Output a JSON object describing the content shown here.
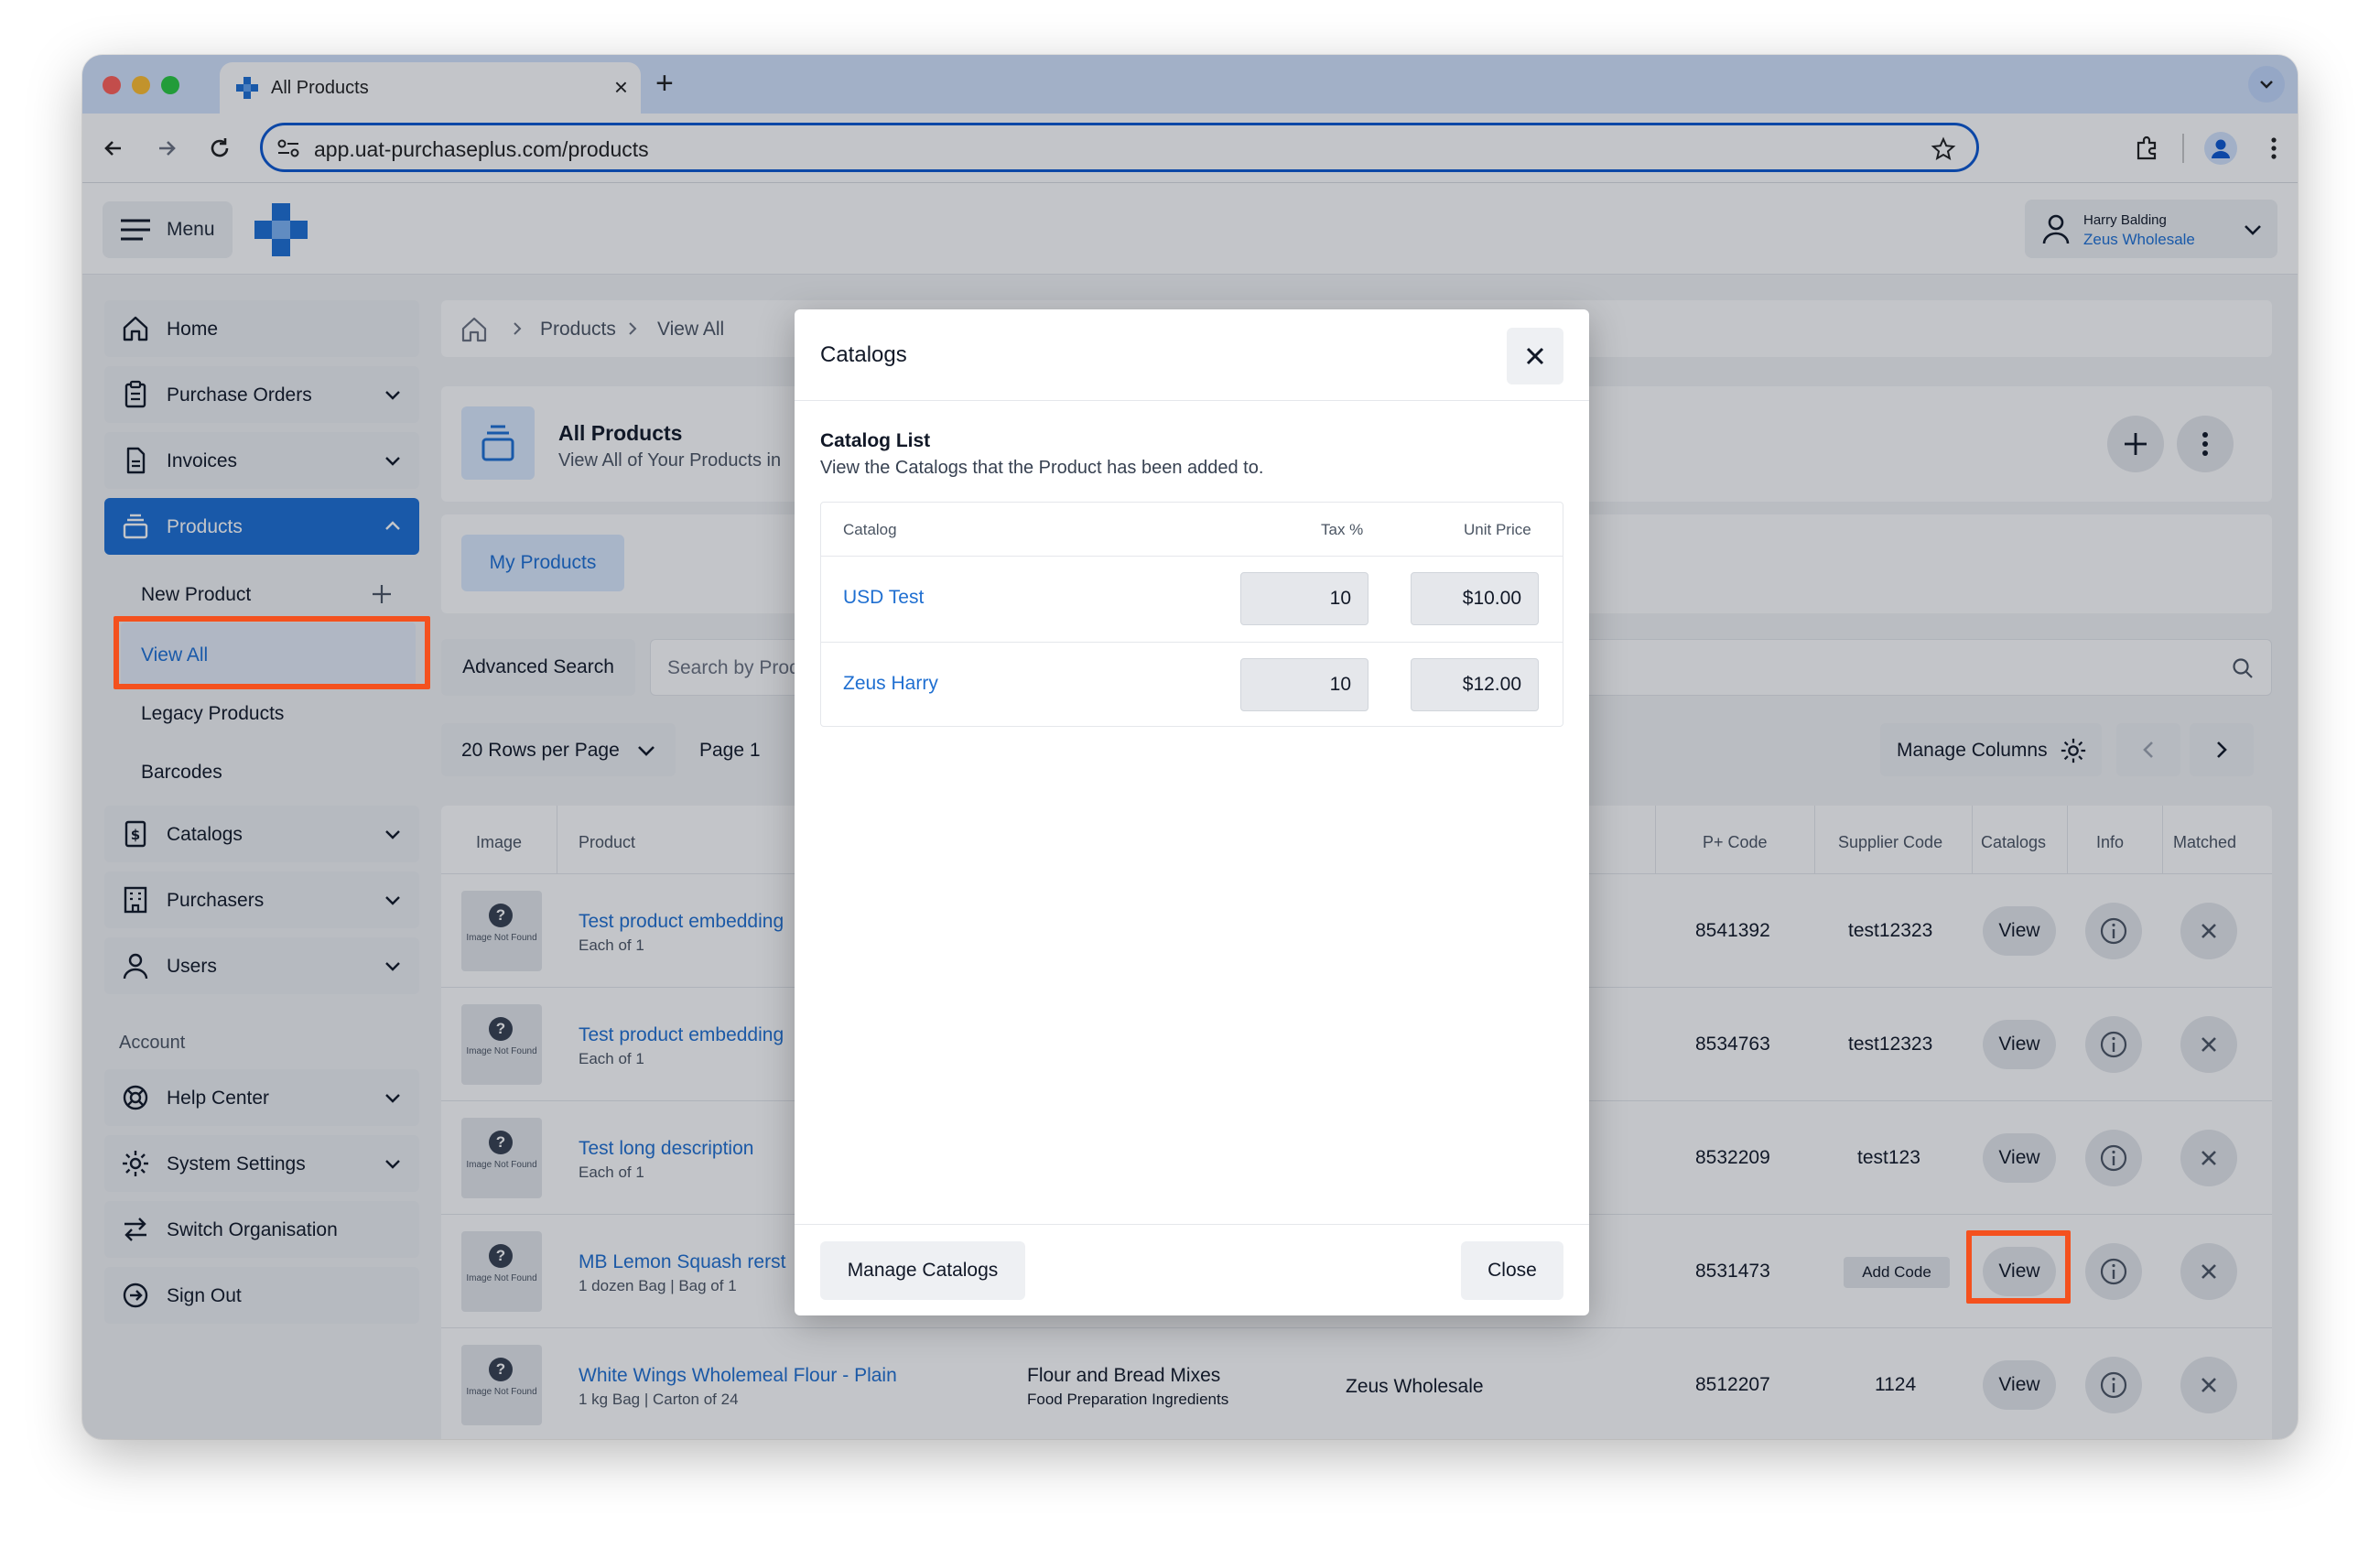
{
  "browser": {
    "tab_title": "All Products",
    "url": "app.uat-purchaseplus.com/products"
  },
  "header": {
    "menu_label": "Menu",
    "user_name": "Harry Balding",
    "user_org": "Zeus Wholesale"
  },
  "sidebar": {
    "items": [
      {
        "label": "Home"
      },
      {
        "label": "Purchase Orders"
      },
      {
        "label": "Invoices"
      },
      {
        "label": "Products"
      },
      {
        "label": "Catalogs"
      },
      {
        "label": "Purchasers"
      },
      {
        "label": "Users"
      }
    ],
    "products_sub": [
      "New Product",
      "View All",
      "Legacy Products",
      "Barcodes"
    ],
    "account_heading": "Account",
    "account_items": [
      {
        "label": "Help Center"
      },
      {
        "label": "System Settings"
      },
      {
        "label": "Switch Organisation"
      },
      {
        "label": "Sign Out"
      }
    ]
  },
  "breadcrumb": {
    "products": "Products",
    "view_all": "View All"
  },
  "page": {
    "title": "All Products",
    "subtitle": "View All of Your Products in",
    "tab_my_products": "My Products",
    "advanced_search": "Advanced Search",
    "search_placeholder": "Search by Prod",
    "rows_per_page": "20 Rows per Page",
    "page_label": "Page 1",
    "manage_columns": "Manage Columns"
  },
  "table": {
    "headers": {
      "image": "Image",
      "product": "Product",
      "p_code": "P+ Code",
      "supplier_code": "Supplier Code",
      "catalogs": "Catalogs",
      "info": "Info",
      "matched": "Matched"
    },
    "image_placeholder": "Image Not Found",
    "view_label": "View",
    "add_code_label": "Add Code",
    "rows": [
      {
        "name": "Test product embedding",
        "sub": "Each of 1",
        "p_code": "8541392",
        "supplier_code": "test12323"
      },
      {
        "name": "Test product embedding",
        "sub": "Each of 1",
        "p_code": "8534763",
        "supplier_code": "test12323"
      },
      {
        "name": "Test long description",
        "sub": "Each of 1",
        "p_code": "8532209",
        "supplier_code": "test123"
      },
      {
        "name": "MB Lemon Squash rerst",
        "sub": "1 dozen Bag | Bag of 1",
        "p_code": "8531473",
        "supplier_code": ""
      },
      {
        "name": "White Wings Wholemeal Flour - Plain",
        "sub": "1 kg Bag | Carton of 24",
        "category": "Flour and Bread Mixes",
        "category_sub": "Food Preparation Ingredients",
        "supplier": "Zeus Wholesale",
        "p_code": "8512207",
        "supplier_code": "1124"
      }
    ]
  },
  "modal": {
    "title": "Catalogs",
    "list_title": "Catalog List",
    "list_subtitle": "View the Catalogs that the Product has been added to.",
    "col_catalog": "Catalog",
    "col_tax": "Tax %",
    "col_price": "Unit Price",
    "rows": [
      {
        "catalog": "USD Test",
        "tax": "10",
        "price": "$10.00"
      },
      {
        "catalog": "Zeus Harry",
        "tax": "10",
        "price": "$12.00"
      }
    ],
    "manage_catalogs": "Manage Catalogs",
    "close": "Close"
  },
  "colors": {
    "accent": "#1c6fd4",
    "highlight": "#f4511e"
  }
}
